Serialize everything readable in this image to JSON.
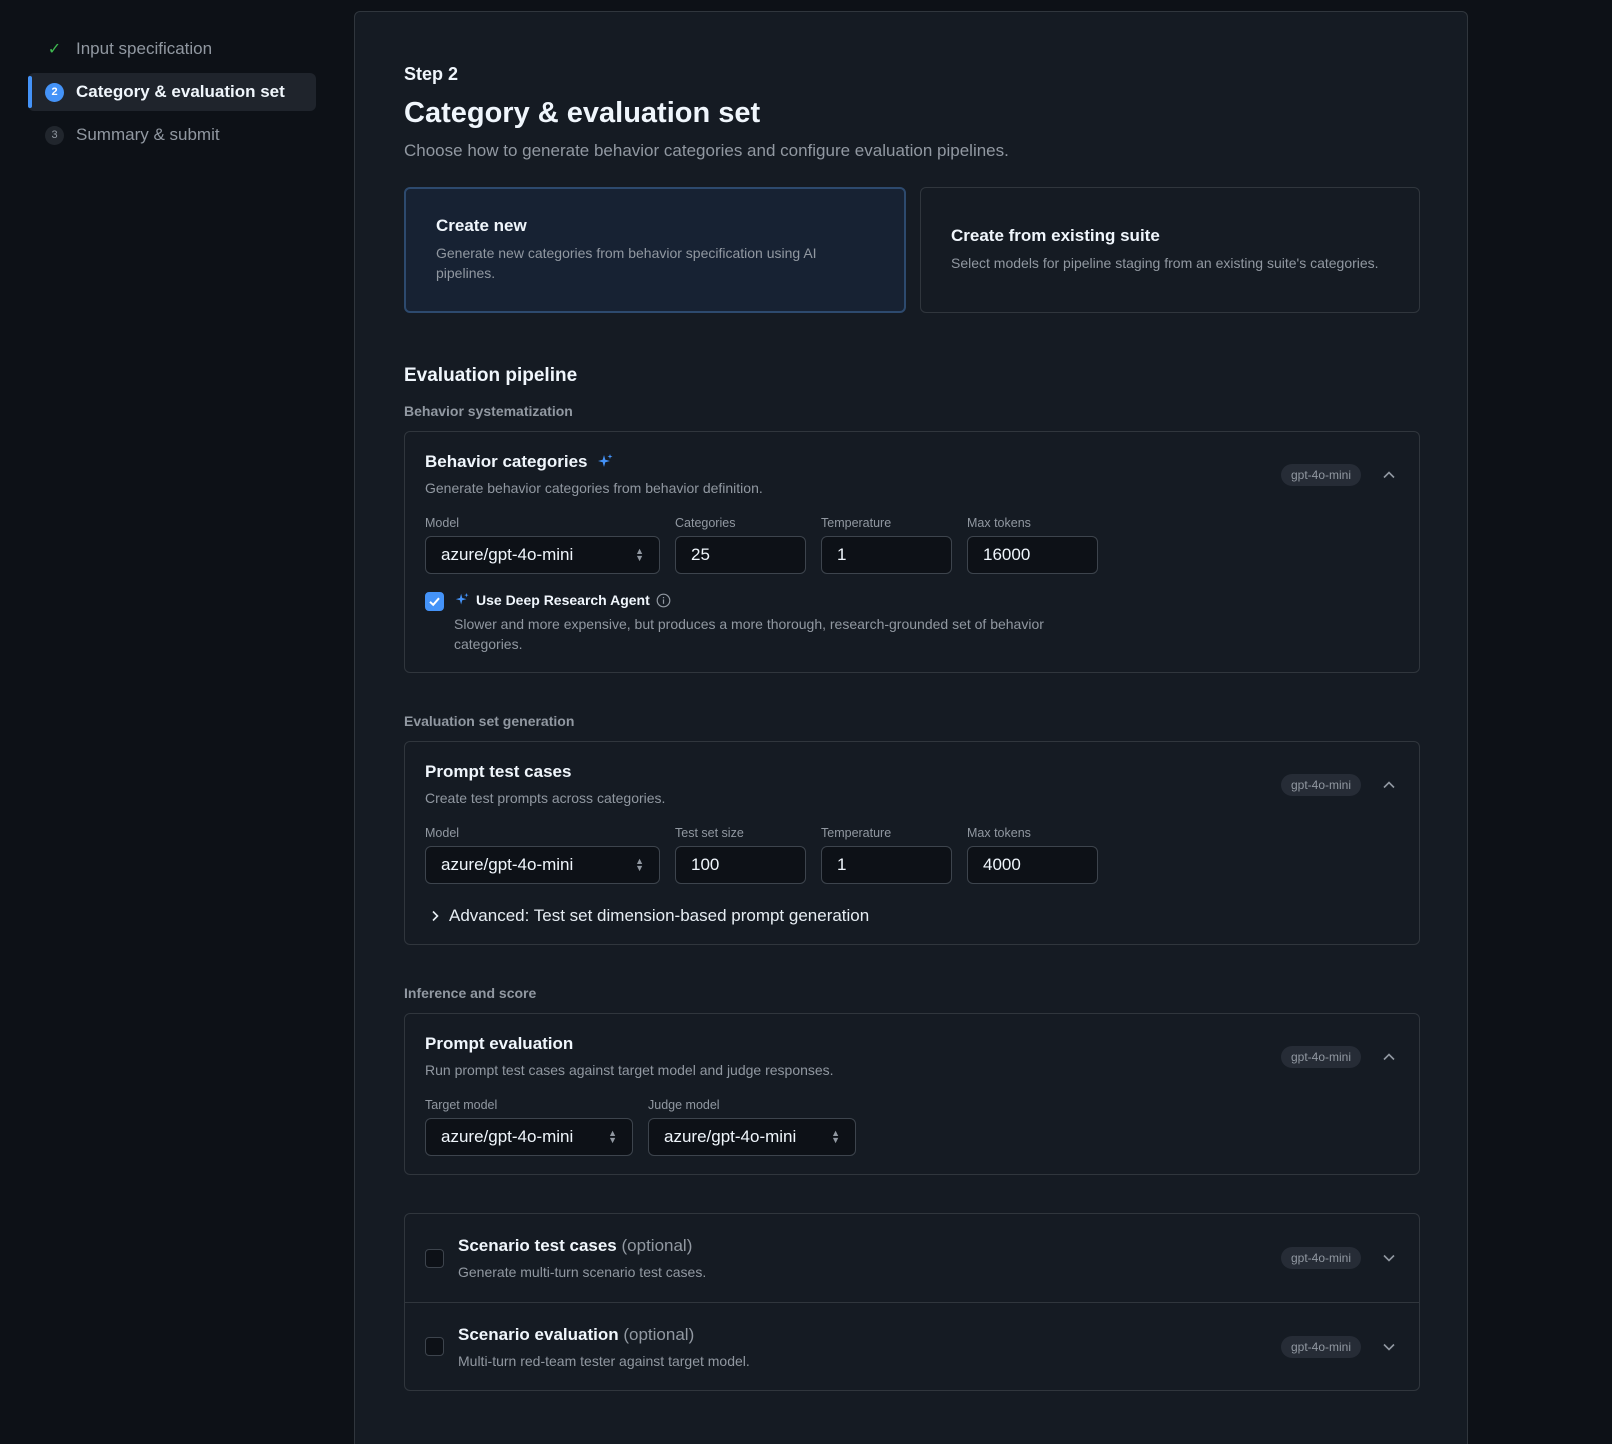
{
  "sidebar": {
    "steps": [
      {
        "label": "Input specification",
        "icon": "check-icon",
        "state": "done"
      },
      {
        "label": "Category & evaluation set",
        "number": "2",
        "state": "active"
      },
      {
        "label": "Summary & submit",
        "number": "3",
        "state": "pending"
      }
    ]
  },
  "header": {
    "step": "Step 2",
    "title": "Category & evaluation set",
    "description": "Choose how to generate behavior categories and configure evaluation pipelines."
  },
  "modes": [
    {
      "title": "Create new",
      "description": "Generate new categories from behavior specification using AI pipelines.",
      "selected": true
    },
    {
      "title": "Create from existing suite",
      "description": "Select models for pipeline staging from an existing suite's categories.",
      "selected": false
    }
  ],
  "pipeline": {
    "title": "Evaluation pipeline",
    "behavior_group": "Behavior systematization",
    "behavior_card": {
      "title": "Behavior categories",
      "description": "Generate behavior categories from behavior definition.",
      "badge": "gpt-4o-mini",
      "model_label": "Model",
      "model_value": "azure/gpt-4o-mini",
      "categories_label": "Categories",
      "categories_value": "25",
      "temperature_label": "Temperature",
      "temperature_value": "1",
      "max_tokens_label": "Max tokens",
      "max_tokens_value": "16000",
      "deep_research_label": "Use Deep Research Agent",
      "deep_research_desc": "Slower and more expensive, but produces a more thorough, research-grounded set of behavior categories.",
      "deep_research_checked": true
    },
    "evalset_group": "Evaluation set generation",
    "prompt_card": {
      "title": "Prompt test cases",
      "description": "Create test prompts across categories.",
      "badge": "gpt-4o-mini",
      "model_label": "Model",
      "model_value": "azure/gpt-4o-mini",
      "size_label": "Test set size",
      "size_value": "100",
      "temperature_label": "Temperature",
      "temperature_value": "1",
      "max_tokens_label": "Max tokens",
      "max_tokens_value": "4000",
      "advanced_label": "Advanced: Test set dimension-based prompt generation"
    },
    "inference_group": "Inference and score",
    "eval_card": {
      "title": "Prompt evaluation",
      "description": "Run prompt test cases against target model and judge responses.",
      "badge": "gpt-4o-mini",
      "target_label": "Target model",
      "target_value": "azure/gpt-4o-mini",
      "judge_label": "Judge model",
      "judge_value": "azure/gpt-4o-mini"
    },
    "optional": [
      {
        "title": "Scenario test cases",
        "optional_text": "(optional)",
        "description": "Generate multi-turn scenario test cases.",
        "badge": "gpt-4o-mini",
        "checked": false
      },
      {
        "title": "Scenario evaluation",
        "optional_text": "(optional)",
        "description": "Multi-turn red-team tester against target model.",
        "badge": "gpt-4o-mini",
        "checked": false
      }
    ]
  },
  "colors": {
    "accent": "#4493f8",
    "success": "#3fb950",
    "background": "#0d1117",
    "panel": "#151b23"
  }
}
